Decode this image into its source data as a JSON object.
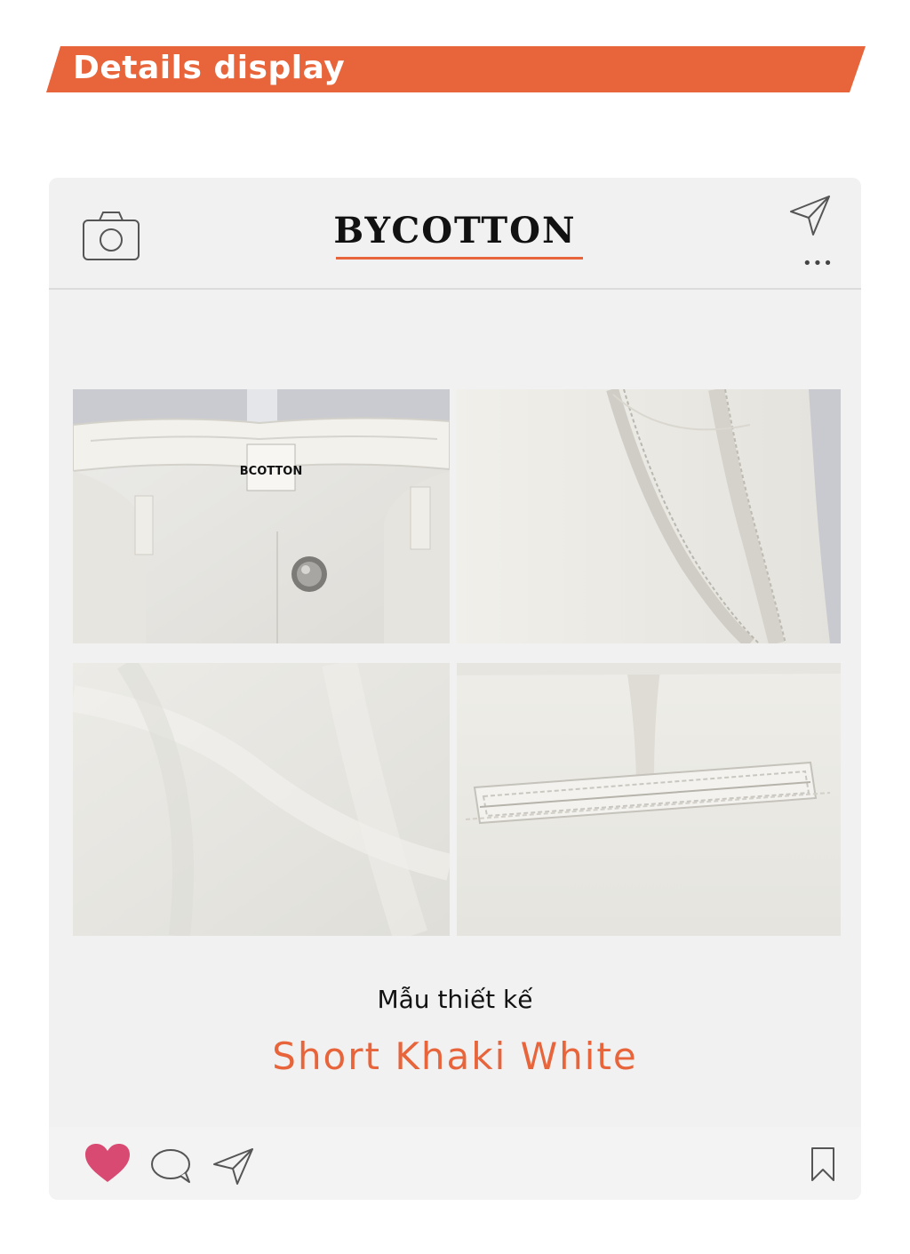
{
  "banner": {
    "title": "Details display",
    "color": "#e8643a"
  },
  "post": {
    "brand": "BYCOTTON",
    "accent_color": "#e8643a",
    "photos": [
      {
        "name": "waistband-button",
        "label_text": "BCOTTON"
      },
      {
        "name": "side-pocket"
      },
      {
        "name": "fabric-texture"
      },
      {
        "name": "back-pocket"
      }
    ],
    "subtitle": "Mẫu thiết kế",
    "product_name": "Short Khaki White",
    "icons": {
      "camera": "camera-icon",
      "send": "send-icon",
      "more": "more-icon",
      "like": "heart-icon",
      "comment": "comment-icon",
      "share": "share-icon",
      "save": "bookmark-icon"
    },
    "like_color": "#d94a72"
  }
}
